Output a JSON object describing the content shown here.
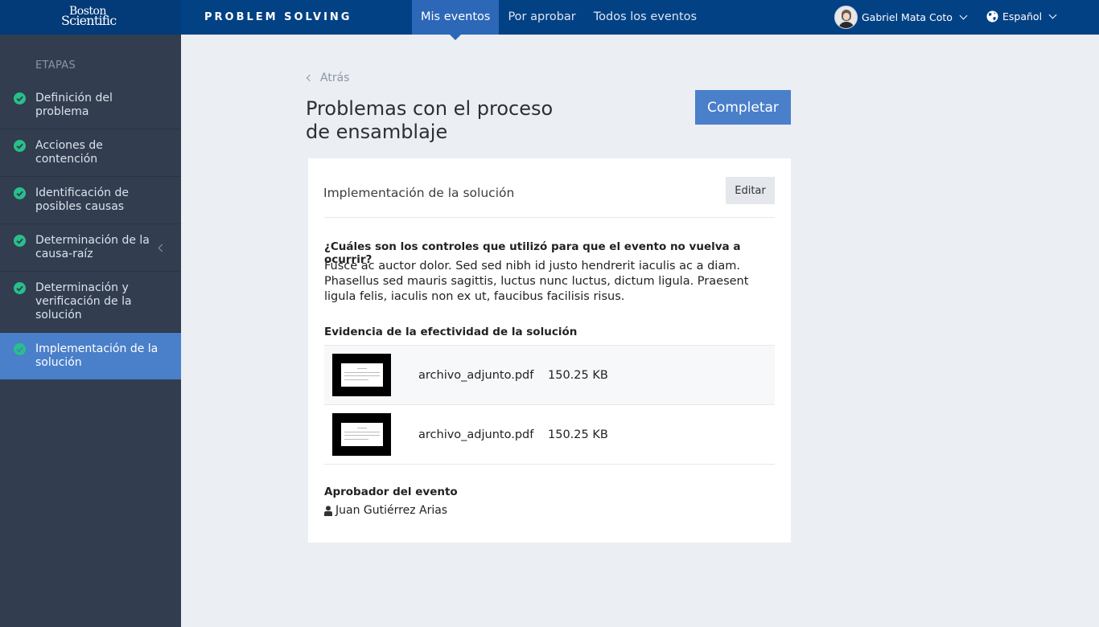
{
  "header": {
    "logo_line1": "Boston",
    "logo_line2": "Scientific",
    "app_title": "PROBLEM SOLVING",
    "nav": [
      {
        "label": "Mis eventos",
        "active": true
      },
      {
        "label": "Por aprobar",
        "active": false
      },
      {
        "label": "Todos los eventos",
        "active": false
      }
    ],
    "user_name": "Gabriel Mata Coto",
    "language": "Español"
  },
  "sidebar": {
    "heading": "ETAPAS",
    "steps": [
      {
        "label": "Definición del problema",
        "done": true
      },
      {
        "label": "Acciones de contención",
        "done": true
      },
      {
        "label": "Identificación de posibles causas",
        "done": true
      },
      {
        "label": "Determinación de la causa-raíz",
        "done": true
      },
      {
        "label": "Determinación y verificación de la solución",
        "done": true
      },
      {
        "label": "Implementación de la solución",
        "done": true,
        "active": true
      }
    ]
  },
  "main": {
    "back_label": "Atrás",
    "title": "Problemas con el proceso de ensamblaje",
    "complete_label": "Completar",
    "card": {
      "title": "Implementación de la solución",
      "edit_label": "Editar",
      "question": "¿Cuáles son los controles que utilizó para que el evento no vuelva a ocurrir?",
      "answer": "Fusce ac auctor dolor. Sed sed nibh id justo hendrerit iaculis ac a diam. Phasellus sed mauris sagittis, luctus nunc luctus, dictum ligula. Praesent ligula felis, iaculis non ex ut, faucibus facilisis risus.",
      "evidence_title": "Evidencia de la efectividad de la solución",
      "files": [
        {
          "name": "archivo_adjunto.pdf",
          "size": "150.25 KB"
        },
        {
          "name": "archivo_adjunto.pdf",
          "size": "150.25 KB"
        }
      ],
      "approver_label": "Aprobador del evento",
      "approver_name": "Juan Gutiérrez Arias"
    }
  },
  "colors": {
    "topbar": "#034185",
    "nav_active": "#2c67b8",
    "sidebar": "#323d4f",
    "sidebar_active": "#4a7fca",
    "check": "#27c08a",
    "primary_button": "#4a7fca"
  }
}
